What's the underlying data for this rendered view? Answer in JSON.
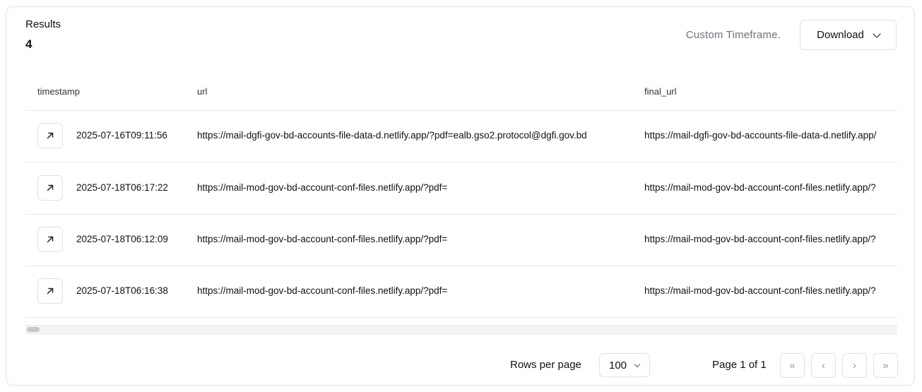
{
  "header": {
    "title": "Results",
    "count": "4",
    "timeframe": "Custom Timeframe.",
    "download_label": "Download"
  },
  "table": {
    "columns": [
      "timestamp",
      "url",
      "final_url"
    ],
    "rows": [
      {
        "timestamp": "2025-07-16T09:11:56",
        "url": "https://mail-dgfi-gov-bd-accounts-file-data-d.netlify.app/?pdf=ealb.gso2.protocol@dgfi.gov.bd",
        "final_url": "https://mail-dgfi-gov-bd-accounts-file-data-d.netlify.app/"
      },
      {
        "timestamp": "2025-07-18T06:17:22",
        "url": "https://mail-mod-gov-bd-account-conf-files.netlify.app/?pdf=",
        "final_url": "https://mail-mod-gov-bd-account-conf-files.netlify.app/?"
      },
      {
        "timestamp": "2025-07-18T06:12:09",
        "url": "https://mail-mod-gov-bd-account-conf-files.netlify.app/?pdf=",
        "final_url": "https://mail-mod-gov-bd-account-conf-files.netlify.app/?"
      },
      {
        "timestamp": "2025-07-18T06:16:38",
        "url": "https://mail-mod-gov-bd-account-conf-files.netlify.app/?pdf=",
        "final_url": "https://mail-mod-gov-bd-account-conf-files.netlify.app/?"
      }
    ]
  },
  "pagination": {
    "rows_per_page_label": "Rows per page",
    "rows_per_page_value": "100",
    "page_info": "Page 1 of 1",
    "first_icon": "«",
    "prev_icon": "‹",
    "next_icon": "›",
    "last_icon": "»"
  },
  "icons": {
    "row_open": "arrow-up-right-icon",
    "download_chevron": "chevron-down-icon"
  }
}
